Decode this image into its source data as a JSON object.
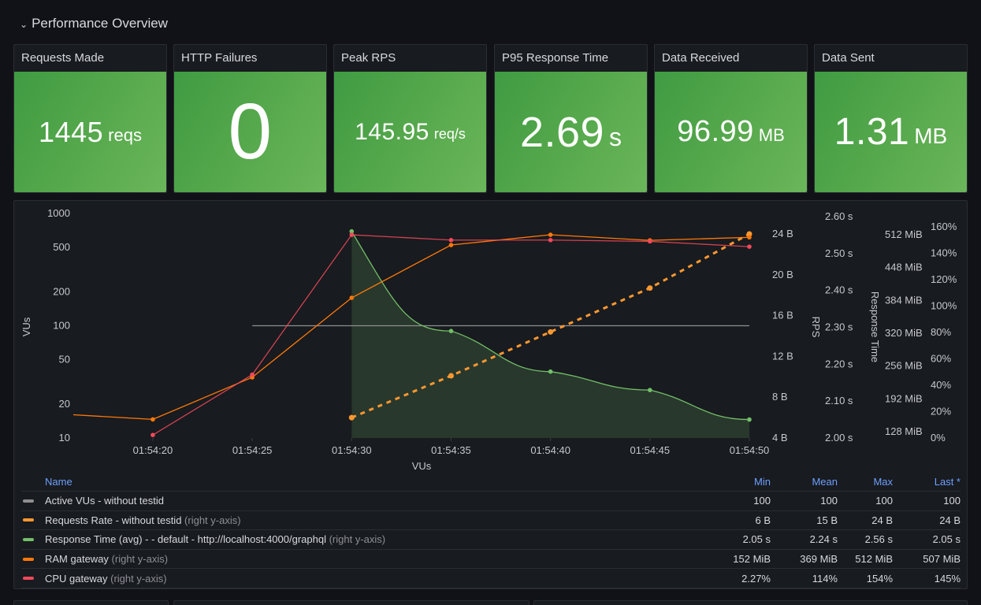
{
  "row": {
    "title": "Performance Overview",
    "icon": "chevron-down-icon"
  },
  "stats": [
    {
      "title": "Requests Made",
      "value": "1445",
      "unit": "reqs"
    },
    {
      "title": "HTTP Failures",
      "value": "0",
      "unit": ""
    },
    {
      "title": "Peak RPS",
      "value": "145.95",
      "unit": "req/s"
    },
    {
      "title": "P95 Response Time",
      "value": "2.69",
      "unit": "s"
    },
    {
      "title": "Data Received",
      "value": "96.99",
      "unit": "MB"
    },
    {
      "title": "Data Sent",
      "value": "1.31",
      "unit": "MB"
    }
  ],
  "colors": {
    "stat_green": "#56a84c",
    "vus": "#8e8e8e",
    "requests": "#ff9830",
    "response": "#73bf69",
    "ram": "#ff780a",
    "cpu": "#f2495c",
    "link_blue": "#6e9fff"
  },
  "chart_data": {
    "type": "line",
    "title": "",
    "xlabel": "VUs",
    "x_ticks": [
      "01:54:20",
      "01:54:25",
      "01:54:30",
      "01:54:35",
      "01:54:40",
      "01:54:45",
      "01:54:50"
    ],
    "x_seconds": [
      20,
      25,
      30,
      35,
      40,
      45,
      50
    ],
    "x_range_seconds": [
      16,
      50
    ],
    "axes": {
      "left": {
        "label": "VUs",
        "scale": "log",
        "range": [
          10,
          1000
        ],
        "ticks": [
          "1000",
          "500",
          "200",
          "100",
          "50",
          "20",
          "10"
        ],
        "tick_values": [
          1000,
          500,
          200,
          100,
          50,
          20,
          10
        ]
      },
      "rps": {
        "label": "RPS",
        "range": [
          4,
          24
        ],
        "ticks": [
          "24 B",
          "20 B",
          "16 B",
          "12 B",
          "8 B",
          "4 B"
        ],
        "tick_values": [
          24,
          20,
          16,
          12,
          8,
          4
        ]
      },
      "response": {
        "label": "Response Time",
        "range": [
          2.0,
          2.6
        ],
        "ticks": [
          "2.60 s",
          "2.50 s",
          "2.40 s",
          "2.30 s",
          "2.20 s",
          "2.10 s",
          "2.00 s"
        ],
        "tick_values": [
          2.6,
          2.5,
          2.4,
          2.3,
          2.2,
          2.1,
          2.0
        ]
      },
      "ram": {
        "label": "",
        "range": [
          128,
          512
        ],
        "ticks": [
          "512 MiB",
          "448 MiB",
          "384 MiB",
          "320 MiB",
          "256 MiB",
          "192 MiB",
          "128 MiB"
        ],
        "tick_values": [
          512,
          448,
          384,
          320,
          256,
          192,
          128
        ]
      },
      "cpu": {
        "label": "",
        "range": [
          0,
          160
        ],
        "ticks": [
          "160%",
          "140%",
          "120%",
          "100%",
          "80%",
          "60%",
          "40%",
          "20%",
          "0%"
        ],
        "tick_values": [
          160,
          140,
          120,
          100,
          80,
          60,
          40,
          20,
          0
        ]
      }
    },
    "series": [
      {
        "name": "Active VUs - without testid",
        "axis": "left",
        "style": "line",
        "x": [
          25,
          50
        ],
        "values": [
          100,
          100
        ]
      },
      {
        "name": "Requests Rate - without testid",
        "axis": "rps",
        "style": "dashed",
        "x": [
          30,
          35,
          40,
          45,
          50
        ],
        "values": [
          6,
          10.1,
          14.4,
          18.7,
          24
        ]
      },
      {
        "name": "Response Time (avg) - - default - http://localhost:4000/graphql",
        "axis": "response",
        "style": "area",
        "x": [
          30,
          35,
          40,
          45,
          50
        ],
        "values": [
          2.56,
          2.29,
          2.18,
          2.13,
          2.05
        ]
      },
      {
        "name": "RAM gateway",
        "axis": "ram",
        "style": "line",
        "x": [
          16,
          20,
          25,
          30,
          35,
          40,
          45,
          50
        ],
        "values": [
          161,
          152,
          234,
          389,
          492,
          512,
          501,
          507
        ]
      },
      {
        "name": "CPU gateway",
        "axis": "cpu",
        "style": "line",
        "x": [
          20,
          25,
          30,
          35,
          40,
          45,
          50
        ],
        "values": [
          2.27,
          48,
          154,
          150,
          150,
          149,
          145
        ]
      }
    ]
  },
  "legend": {
    "headers": {
      "name": "Name",
      "min": "Min",
      "mean": "Mean",
      "max": "Max",
      "last": "Last *"
    },
    "rows": [
      {
        "name": "Active VUs - without testid",
        "hint": "",
        "color": "#8e8e8e",
        "min": "100",
        "mean": "100",
        "max": "100",
        "last": "100"
      },
      {
        "name": "Requests Rate - without testid",
        "hint": "(right y-axis)",
        "color": "#ff9830",
        "min": "6 B",
        "mean": "15 B",
        "max": "24 B",
        "last": "24 B"
      },
      {
        "name": "Response Time (avg) - - default - http://localhost:4000/graphql",
        "hint": "(right y-axis)",
        "color": "#73bf69",
        "min": "2.05 s",
        "mean": "2.24 s",
        "max": "2.56 s",
        "last": "2.05 s"
      },
      {
        "name": "RAM gateway",
        "hint": "(right y-axis)",
        "color": "#ff780a",
        "min": "152 MiB",
        "mean": "369 MiB",
        "max": "512 MiB",
        "last": "507 MiB"
      },
      {
        "name": "CPU gateway",
        "hint": "(right y-axis)",
        "color": "#f2495c",
        "min": "2.27%",
        "mean": "114%",
        "max": "154%",
        "last": "145%"
      }
    ]
  }
}
